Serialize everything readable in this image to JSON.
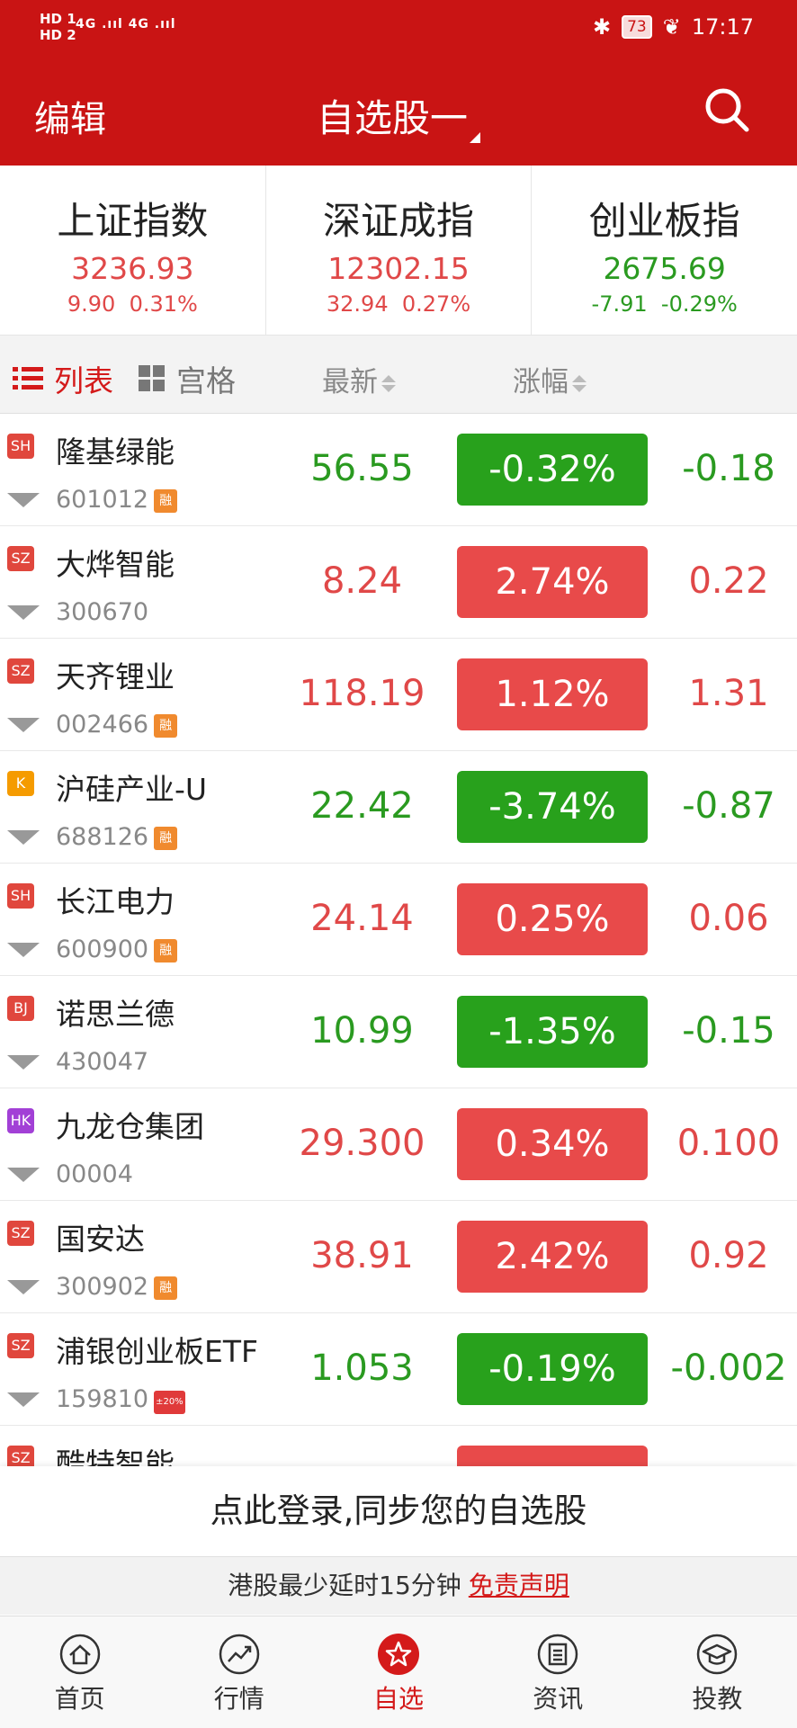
{
  "status": {
    "sim1": "HD 1",
    "sim2": "HD 2",
    "signal_left": "4G .ııl 4G .ııl",
    "battery": "73",
    "time": "17:17"
  },
  "nav": {
    "edit": "编辑",
    "title": "自选股一"
  },
  "indices": [
    {
      "name": "上证指数",
      "value": "3236.93",
      "change": "9.90",
      "percent": "0.31%",
      "dir": "up"
    },
    {
      "name": "深证成指",
      "value": "12302.15",
      "change": "32.94",
      "percent": "0.27%",
      "dir": "up"
    },
    {
      "name": "创业板指",
      "value": "2675.69",
      "change": "-7.91",
      "percent": "-0.29%",
      "dir": "down"
    }
  ],
  "columns": {
    "list": "列表",
    "grid": "宫格",
    "latest": "最新",
    "change": "涨幅"
  },
  "stocks": [
    {
      "market": "SH",
      "name": "隆基绿能",
      "code": "601012",
      "tag": "融",
      "price": "56.55",
      "percent": "-0.32%",
      "delta": "-0.18",
      "dir": "down"
    },
    {
      "market": "SZ",
      "name": "大烨智能",
      "code": "300670",
      "tag": "",
      "price": "8.24",
      "percent": "2.74%",
      "delta": "0.22",
      "dir": "up"
    },
    {
      "market": "SZ",
      "name": "天齐锂业",
      "code": "002466",
      "tag": "融",
      "price": "118.19",
      "percent": "1.12%",
      "delta": "1.31",
      "dir": "up"
    },
    {
      "market": "K",
      "name": "沪硅产业-U",
      "code": "688126",
      "tag": "融",
      "price": "22.42",
      "percent": "-3.74%",
      "delta": "-0.87",
      "dir": "down"
    },
    {
      "market": "SH",
      "name": "长江电力",
      "code": "600900",
      "tag": "融",
      "price": "24.14",
      "percent": "0.25%",
      "delta": "0.06",
      "dir": "up"
    },
    {
      "market": "BJ",
      "name": "诺思兰德",
      "code": "430047",
      "tag": "",
      "price": "10.99",
      "percent": "-1.35%",
      "delta": "-0.15",
      "dir": "down"
    },
    {
      "market": "HK",
      "name": "九龙仓集团",
      "code": "00004",
      "tag": "",
      "price": "29.300",
      "percent": "0.34%",
      "delta": "0.100",
      "dir": "up"
    },
    {
      "market": "SZ",
      "name": "国安达",
      "code": "300902",
      "tag": "融",
      "price": "38.91",
      "percent": "2.42%",
      "delta": "0.92",
      "dir": "up"
    },
    {
      "market": "SZ",
      "name": "浦银创业板ETF",
      "code": "159810",
      "tag": "±20%",
      "price": "1.053",
      "percent": "-0.19%",
      "delta": "-0.002",
      "dir": "down"
    },
    {
      "market": "SZ",
      "name": "酷特智能",
      "code": "",
      "tag": "",
      "price": "",
      "percent": "",
      "delta": "",
      "dir": "up"
    }
  ],
  "colors": {
    "brand": "#c91414",
    "up": "#e04848",
    "down": "#2a9a20",
    "SH": "#e0473d",
    "SZ": "#e0473d",
    "K": "#f59b00",
    "BJ": "#e0473d",
    "HK": "#a240d6"
  },
  "login_banner": "点此登录,同步您的自选股",
  "disclaimer": {
    "text": "港股最少延时15分钟",
    "link": "免责声明"
  },
  "tabs": [
    {
      "label": "首页",
      "icon": "home-icon"
    },
    {
      "label": "行情",
      "icon": "market-trend-icon"
    },
    {
      "label": "自选",
      "icon": "star-icon",
      "active": true
    },
    {
      "label": "资讯",
      "icon": "news-icon"
    },
    {
      "label": "投教",
      "icon": "graduation-cap-icon"
    }
  ]
}
